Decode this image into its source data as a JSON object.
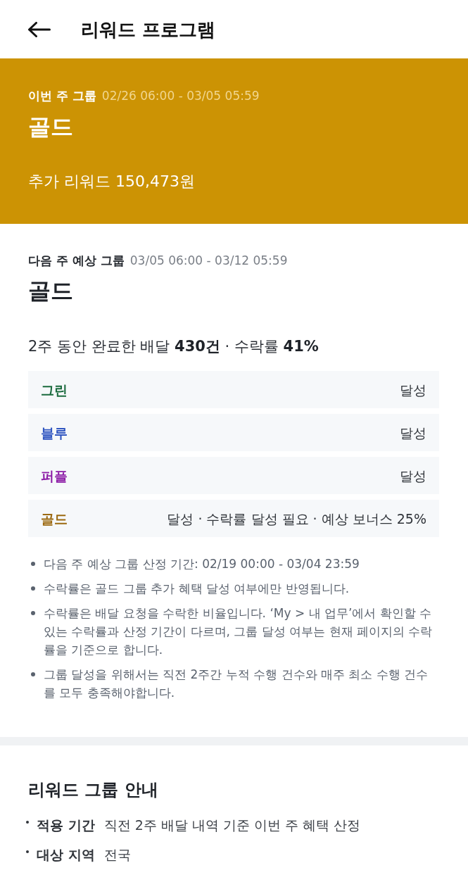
{
  "header": {
    "title": "리워드 프로그램"
  },
  "current_group": {
    "label": "이번 주 그룹",
    "period": "02/26 06:00 - 03/05 05:59",
    "group": "골드",
    "reward": "추가 리워드 150,473원"
  },
  "next_group": {
    "label": "다음 주 예상 그룹",
    "period": "03/05 06:00 - 03/12 05:59",
    "group": "골드",
    "summary": "2주 동안 완료한 배달 **430건** · 수락률 **41%**",
    "tiers": [
      {
        "name": "그린",
        "status": "달성",
        "color": "#1b6b3e"
      },
      {
        "name": "블루",
        "status": "달성",
        "color": "#2f55c0"
      },
      {
        "name": "퍼플",
        "status": "달성",
        "color": "#8c1ca6"
      },
      {
        "name": "골드",
        "status": "달성 · 수락률 달성 필요 · 예상 보너스 25%",
        "color": "#9c6a12"
      }
    ]
  },
  "notes": [
    "다음 주 예상 그룹 산정 기간: 02/19 00:00 - 03/04 23:59",
    "수락률은 골드 그룹 추가 혜택 달성 여부에만 반영됩니다.",
    "수락률은 배달 요청을 수락한 비율입니다. ‘My > 내 업무’에서 확인할 수 있는 수락률과 산정 기간이 다르며, 그룹 달성 여부는 현재 페이지의 수락률을 기준으로 합니다.",
    "그룹 달성을 위해서는 직전 2주간 누적 수행 건수와 매주 최소 수행 건수를 모두 충족해야합니다."
  ],
  "guide": {
    "title": "리워드 그룹 안내",
    "items": [
      {
        "label": "적용 기간",
        "value": "직전 2주 배달 내역 기준 이번 주 혜택 산정"
      },
      {
        "label": "대상 지역",
        "value": "전국"
      }
    ]
  }
}
